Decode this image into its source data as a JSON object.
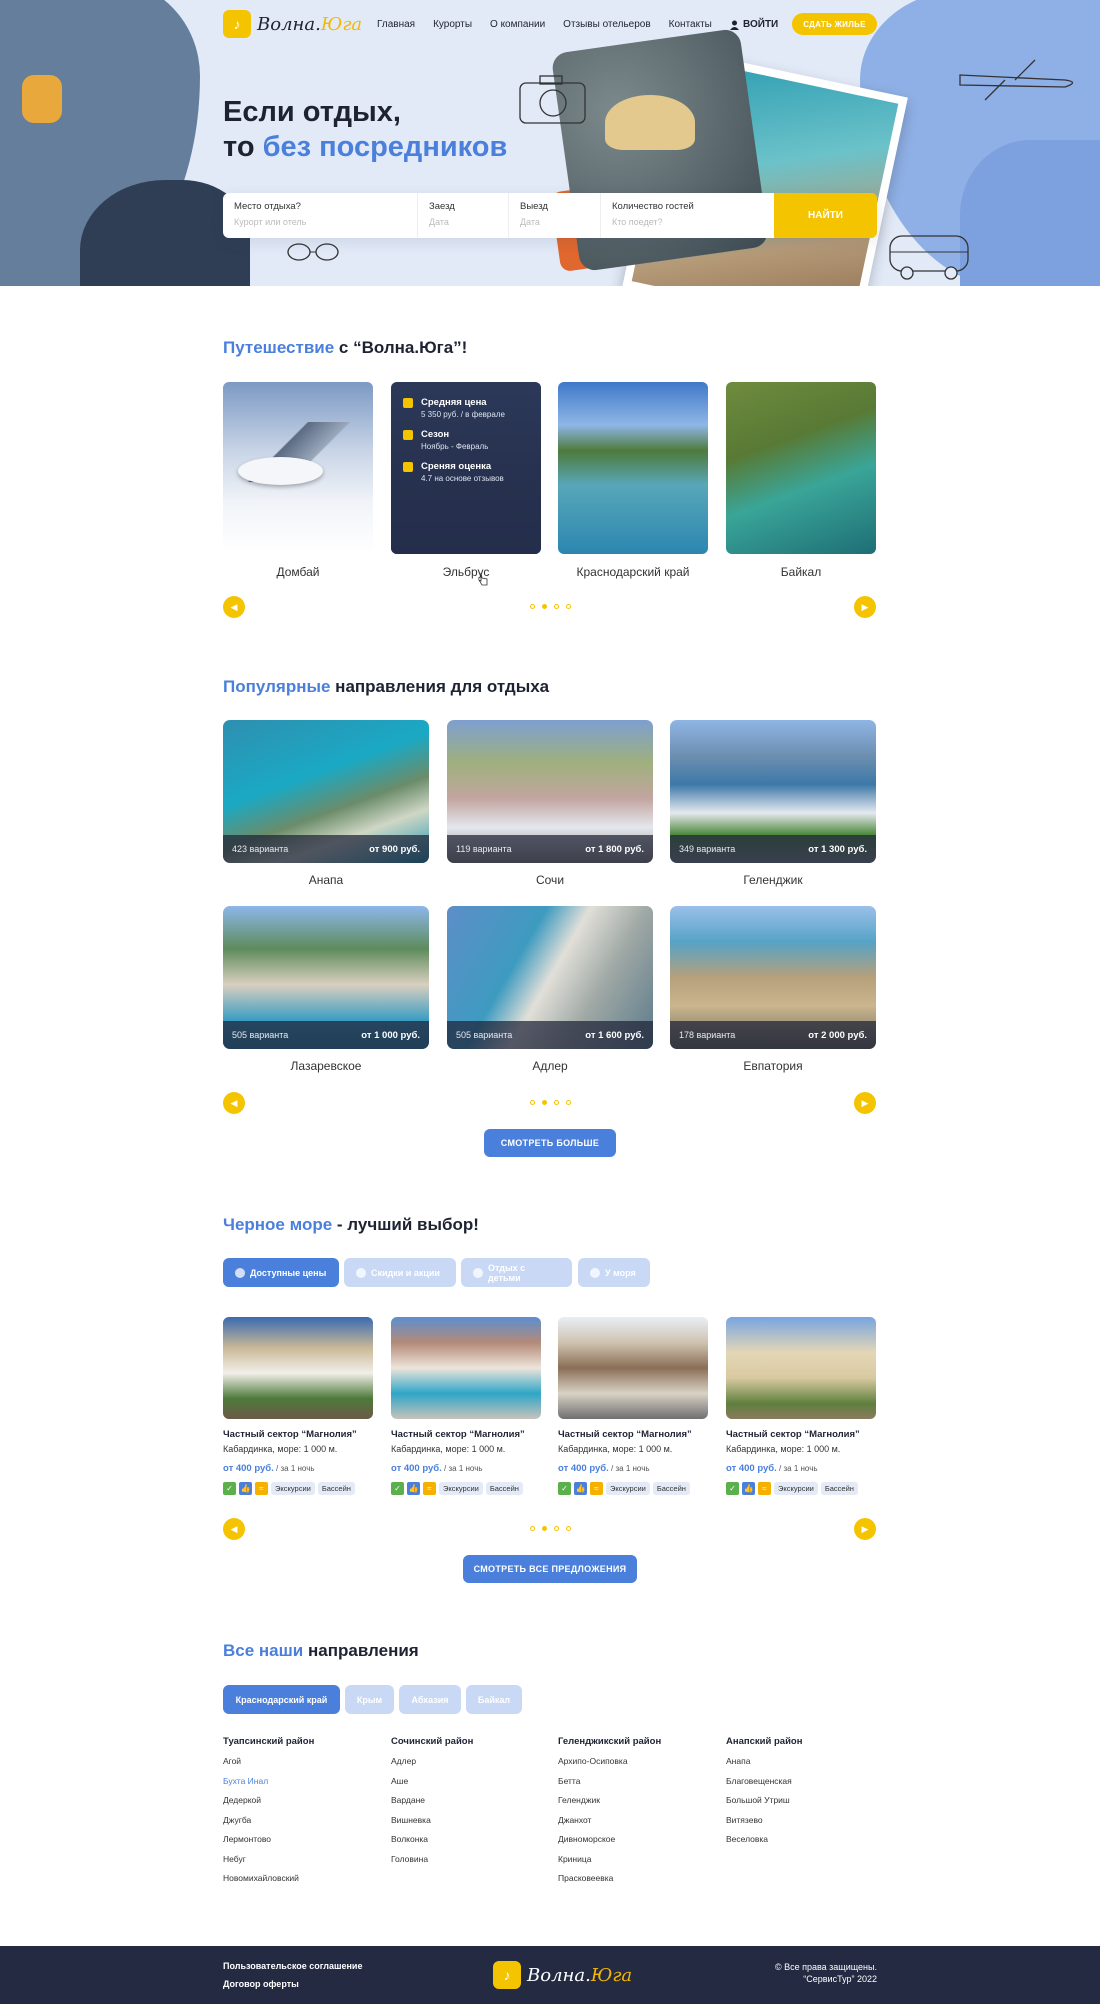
{
  "header": {
    "logo_text_a": "Волна.",
    "logo_text_b": "Юга",
    "nav": [
      "Главная",
      "Курорты",
      "О компании",
      "Отзывы отельеров",
      "Контакты"
    ],
    "login": "ВОЙТИ",
    "rent_button": "СДАТЬ ЖИЛЬЕ"
  },
  "hero": {
    "title_line1": "Если отдых,",
    "title_line2_a": "то ",
    "title_line2_b": "без посредников"
  },
  "search": {
    "place_label": "Место отдыха?",
    "place_placeholder": "Курорт или отель",
    "checkin_label": "Заезд",
    "checkin_placeholder": "Дата",
    "checkout_label": "Выезд",
    "checkout_placeholder": "Дата",
    "guests_label": "Количество гостей",
    "guests_placeholder": "Кто поедет?",
    "button": "НАЙТИ"
  },
  "travel": {
    "title_a": "Путешествие",
    "title_b": " с “Волна.Юга”!",
    "cards": [
      {
        "name": "Домбай"
      },
      {
        "name": "Эльбрус"
      },
      {
        "name": "Краснодарский край"
      },
      {
        "name": "Байкал"
      }
    ],
    "info": {
      "price_label": "Средняя цена",
      "price_value": "5 350 руб. / в феврале",
      "season_label": "Сезон",
      "season_value": "Ноябрь - Февраль",
      "rating_label": "Среняя оценка",
      "rating_value": "4.7 на основе отзывов"
    }
  },
  "popular": {
    "title_a": "Популярные",
    "title_b": " направления для отдыха",
    "cards": [
      {
        "name": "Анапа",
        "variants": "423 варианта",
        "price": "от 900 руб."
      },
      {
        "name": "Сочи",
        "variants": "119 варианта",
        "price": "от 1 800 руб."
      },
      {
        "name": "Геленджик",
        "variants": "349 варианта",
        "price": "от 1 300 руб."
      },
      {
        "name": "Лазаревское",
        "variants": "505 варианта",
        "price": "от 1 000 руб."
      },
      {
        "name": "Адлер",
        "variants": "505 варианта",
        "price": "от 1 600 руб."
      },
      {
        "name": "Евпатория",
        "variants": "178 варианта",
        "price": "от 2 000 руб."
      }
    ],
    "more_button": "СМОТРЕТЬ БОЛЬШЕ"
  },
  "blacksea": {
    "title_a": "Черное море",
    "title_b": " - лучший выбор!",
    "tabs": [
      "Доступные цены",
      "Скидки и акции",
      "Отдых с детьми",
      "У моря"
    ],
    "hotels": [
      {
        "name": "Частный сектор “Магнолия”",
        "addr": "Кабардинка, море: 1 000 м.",
        "price": "от 400 руб.",
        "per": " / за 1 ночь"
      },
      {
        "name": "Частный сектор “Магнолия”",
        "addr": "Кабардинка, море: 1 000 м.",
        "price": "от 400 руб.",
        "per": " / за 1 ночь"
      },
      {
        "name": "Частный сектор “Магнолия”",
        "addr": "Кабардинка, море: 1 000 м.",
        "price": "от 400 руб.",
        "per": " / за 1 ночь"
      },
      {
        "name": "Частный сектор “Магнолия”",
        "addr": "Кабардинка, море: 1 000 м.",
        "price": "от 400 руб.",
        "per": " / за 1 ночь"
      }
    ],
    "tag1": "Экскурсии",
    "tag2": "Бассейн",
    "all_button": "СМОТРЕТЬ ВСЕ ПРЕДЛОЖЕНИЯ"
  },
  "directions": {
    "title_a": "Все наши",
    "title_b": " направления",
    "tabs": [
      "Краснодарский край",
      "Крым",
      "Абхазия",
      "Байкал"
    ],
    "columns": [
      {
        "head": "Туапсинский район",
        "items": [
          "Агой",
          "Бухта Инал",
          "Дедеркой",
          "Джугба",
          "Лермонтово",
          "Небуг",
          "Новомихайловский"
        ]
      },
      {
        "head": "Сочинский район",
        "items": [
          "Адлер",
          "Аше",
          "Вардане",
          "Вишневка",
          "Волконка",
          "Головина"
        ]
      },
      {
        "head": "Геленджикский район",
        "items": [
          "Архипо-Осиповка",
          "Бетта",
          "Геленджик",
          "Джанхот",
          "Дивноморское",
          "Криница",
          "Прасковеевка"
        ]
      },
      {
        "head": "Анапский район",
        "items": [
          "Анапа",
          "Благовещенская",
          "Большой Утриш",
          "Витязево",
          "Веселовка"
        ]
      }
    ]
  },
  "footer": {
    "link1": "Пользовательское соглашение",
    "link2": "Договор оферты",
    "copy1": "© Все права защищены.",
    "copy2": "“СервисТур” 2022"
  },
  "colors": {
    "accent": "#f5c400",
    "brand_blue": "#4a7fdc",
    "dark": "#232a42"
  }
}
